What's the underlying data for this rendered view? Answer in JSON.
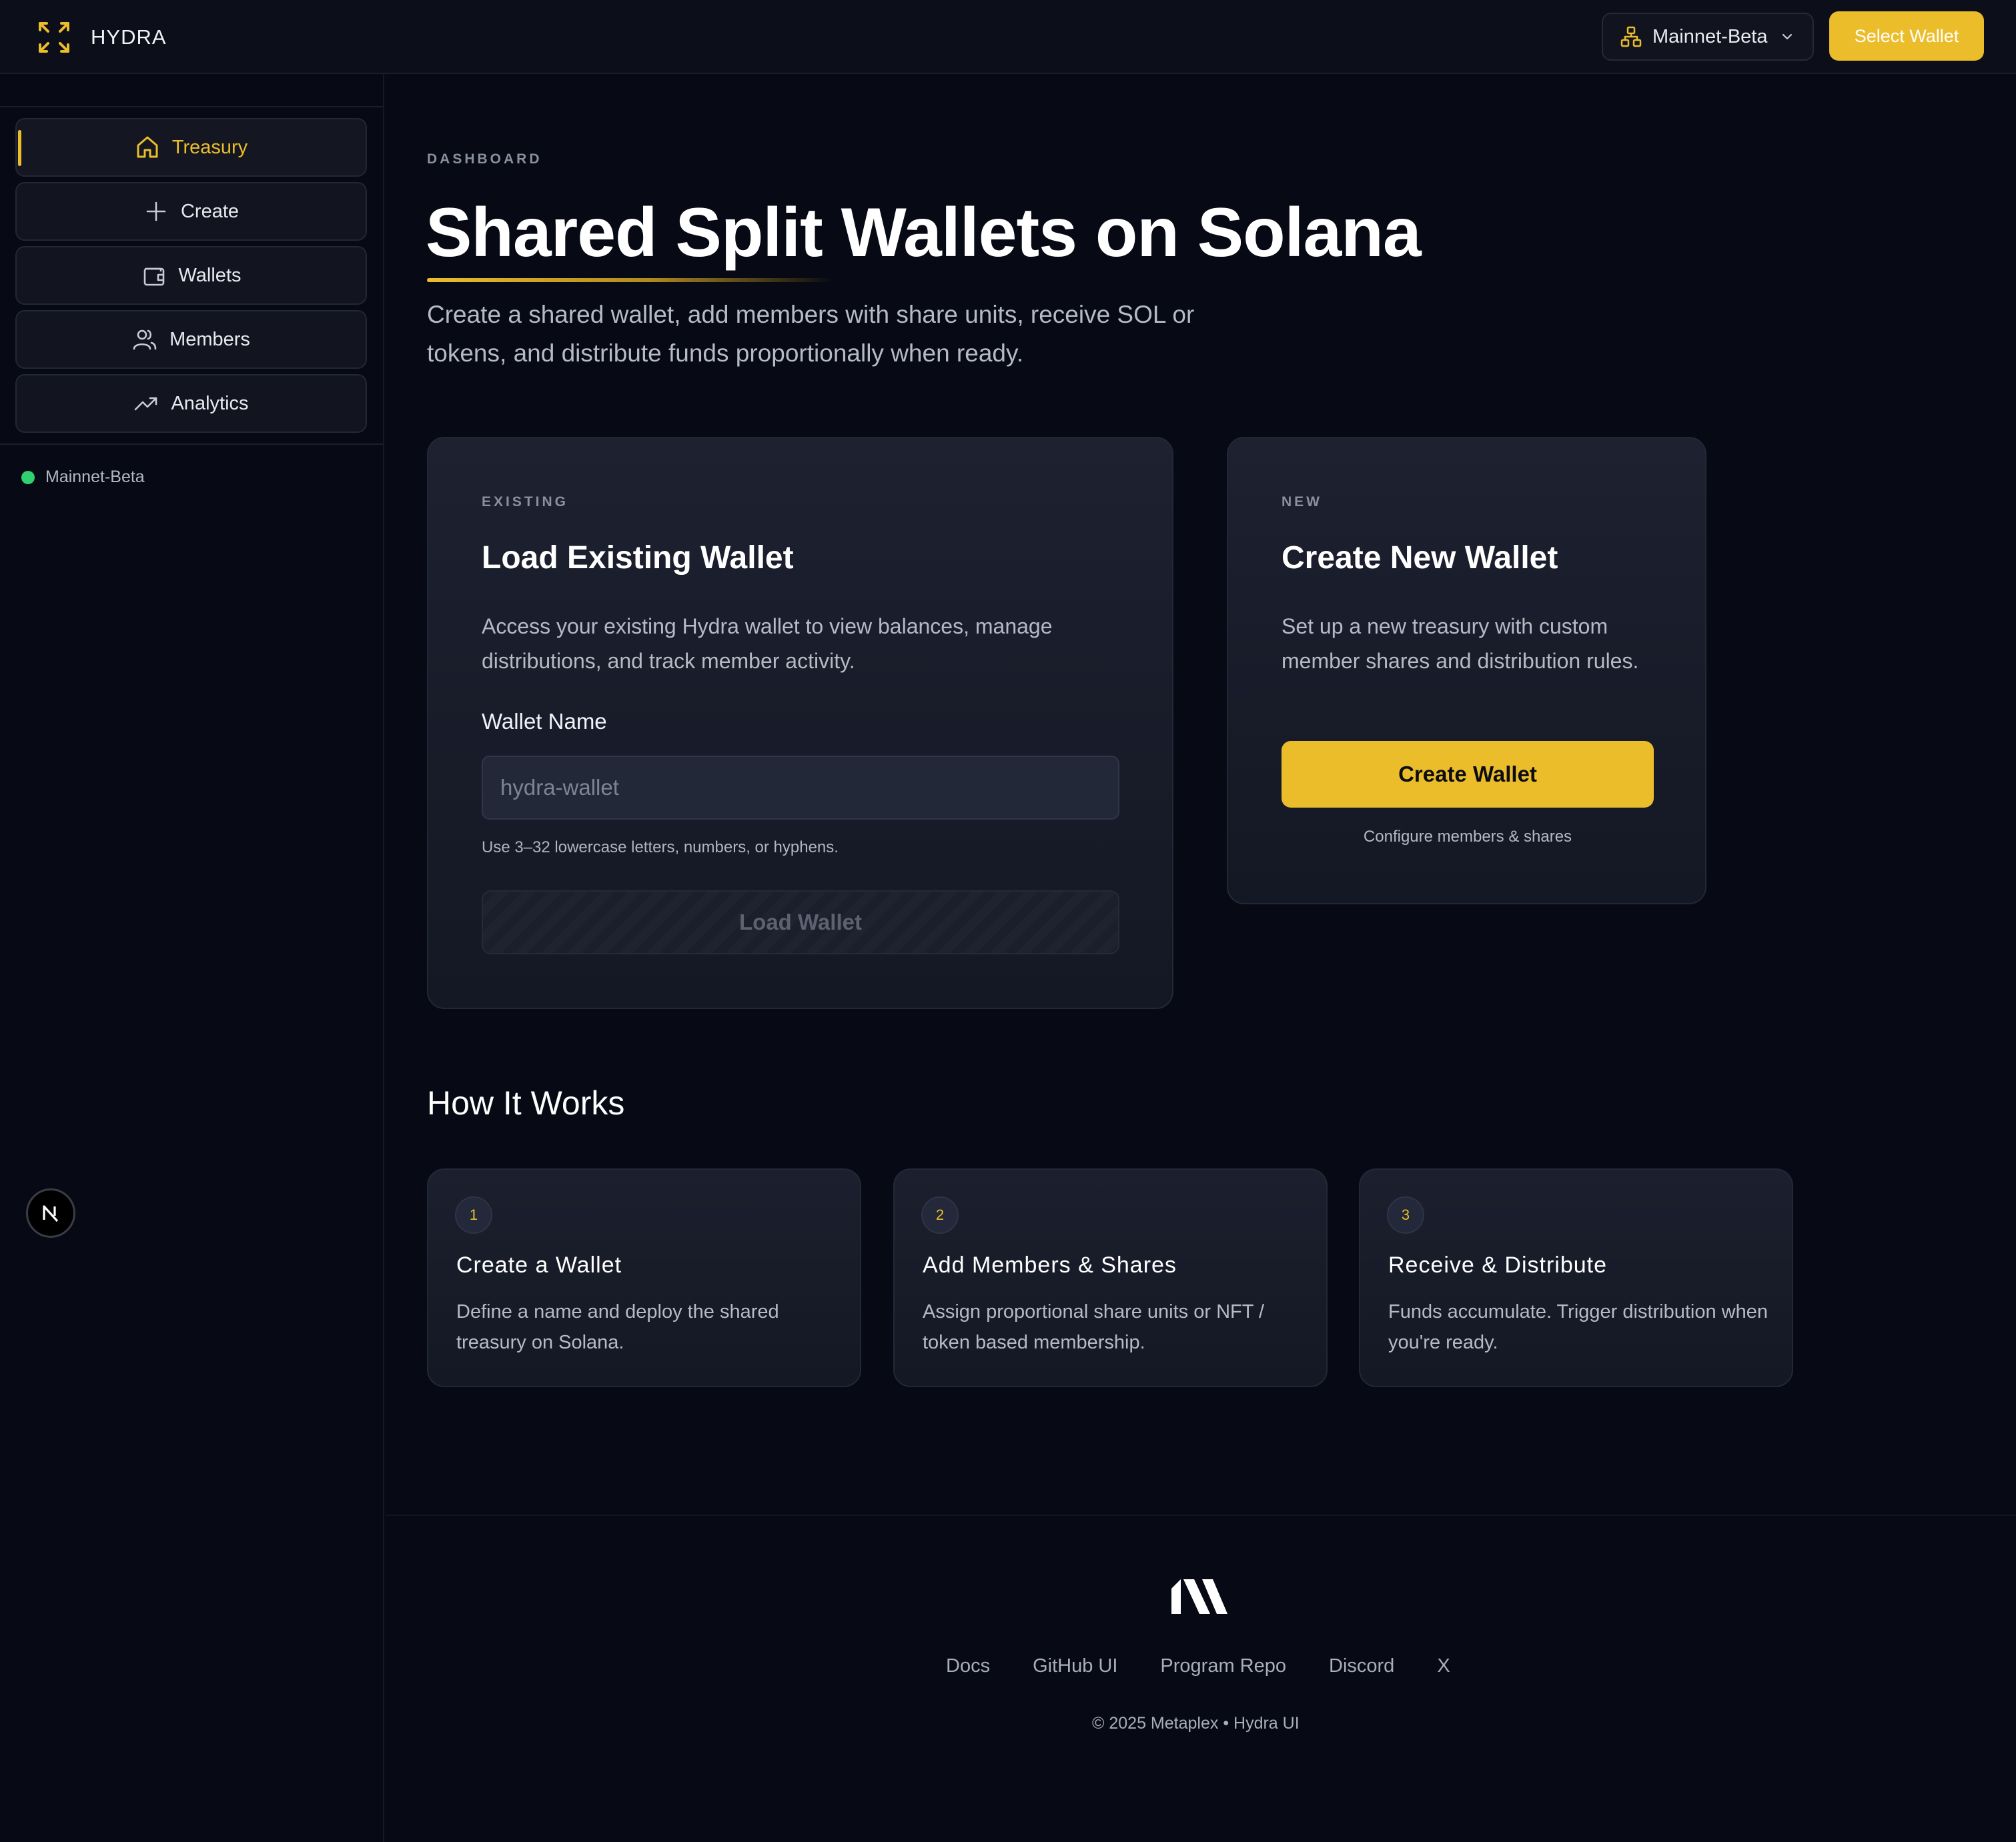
{
  "app": {
    "name": "HYDRA",
    "network_label": "Mainnet-Beta",
    "select_wallet_label": "Select Wallet"
  },
  "colors": {
    "accent": "#ecbd2b",
    "background": "#070a14",
    "status_online": "#2fd072"
  },
  "sidebar": {
    "items": [
      {
        "label": "Treasury",
        "icon": "home-icon",
        "active": true
      },
      {
        "label": "Create",
        "icon": "plus-icon",
        "active": false
      },
      {
        "label": "Wallets",
        "icon": "wallet-icon",
        "active": false
      },
      {
        "label": "Members",
        "icon": "users-icon",
        "active": false
      },
      {
        "label": "Analytics",
        "icon": "trending-up-icon",
        "active": false
      }
    ],
    "status_label": "Mainnet-Beta",
    "badge_letter": "N"
  },
  "hero": {
    "eyebrow": "DASHBOARD",
    "title": "Shared Split Wallets on Solana",
    "subtitle": "Create a shared wallet, add members with share units, receive SOL or tokens, and distribute funds proportionally when ready."
  },
  "load_card": {
    "eyebrow": "EXISTING",
    "title": "Load Existing Wallet",
    "description": "Access your existing Hydra wallet to view balances, manage distributions, and track member activity.",
    "field_label": "Wallet Name",
    "input_placeholder": "hydra-wallet",
    "input_value": "",
    "hint": "Use 3–32 lowercase letters, numbers, or hyphens.",
    "button_label": "Load Wallet"
  },
  "create_card": {
    "eyebrow": "NEW",
    "title": "Create New Wallet",
    "description": "Set up a new treasury with custom member shares and distribution rules.",
    "button_label": "Create Wallet",
    "hint": "Configure members & shares"
  },
  "how_it_works": {
    "title": "How It Works",
    "steps": [
      {
        "number": "1",
        "title": "Create a Wallet",
        "description": "Define a name and deploy the shared treasury on Solana."
      },
      {
        "number": "2",
        "title": "Add Members & Shares",
        "description": "Assign proportional share units or NFT / token based membership."
      },
      {
        "number": "3",
        "title": "Receive & Distribute",
        "description": "Funds accumulate. Trigger distribution when you're ready."
      }
    ]
  },
  "footer": {
    "links": [
      "Docs",
      "GitHub UI",
      "Program Repo",
      "Discord",
      "X"
    ],
    "copyright": "© 2025 Metaplex • Hydra UI"
  }
}
